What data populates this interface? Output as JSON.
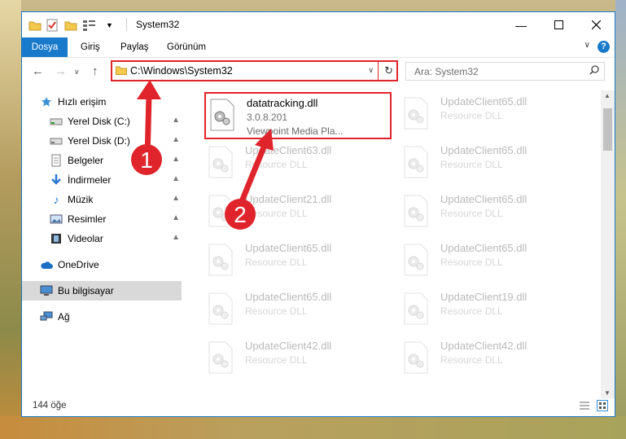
{
  "title": "System32",
  "ribbon": {
    "tabs": [
      "Dosya",
      "Giriş",
      "Paylaş",
      "Görünüm"
    ]
  },
  "address": {
    "path": "C:\\Windows\\System32"
  },
  "search": {
    "placeholder": "Ara: System32"
  },
  "sidebar": {
    "quick_access": "Hızlı erişim",
    "items": [
      {
        "label": "Yerel Disk (C:)"
      },
      {
        "label": "Yerel Disk (D:)"
      },
      {
        "label": "Belgeler"
      },
      {
        "label": "İndirmeler"
      },
      {
        "label": "Müzik"
      },
      {
        "label": "Resimler"
      },
      {
        "label": "Videolar"
      }
    ],
    "onedrive": "OneDrive",
    "this_pc": "Bu bilgisayar",
    "network": "Ağ"
  },
  "files": {
    "selected": {
      "name": "datatracking.dll",
      "version": "3.0.8.201",
      "description": "Viewpoint Media Pla..."
    },
    "others": [
      {
        "name": "UpdateClient65.dll",
        "desc": "Resource DLL"
      },
      {
        "name": "UpdateClient63.dll",
        "desc": "Resource DLL"
      },
      {
        "name": "UpdateClient65.dll",
        "desc": "Resource DLL"
      },
      {
        "name": "UpdateClient21.dll",
        "desc": "Resource DLL"
      },
      {
        "name": "UpdateClient65.dll",
        "desc": "Resource DLL"
      },
      {
        "name": "UpdateClient65.dll",
        "desc": "Resource DLL"
      },
      {
        "name": "UpdateClient65.dll",
        "desc": "Resource DLL"
      },
      {
        "name": "UpdateClient65.dll",
        "desc": "Resource DLL"
      },
      {
        "name": "UpdateClient19.dll",
        "desc": "Resource DLL"
      },
      {
        "name": "UpdateClient42.dll",
        "desc": "Resource DLL"
      },
      {
        "name": "UpdateClient42.dll",
        "desc": "Resource DLL"
      }
    ]
  },
  "status": {
    "count": "144 öğe"
  },
  "annotations": {
    "step1": "1",
    "step2": "2"
  },
  "colors": {
    "accent": "#1979ca",
    "highlight": "#e0242b"
  }
}
